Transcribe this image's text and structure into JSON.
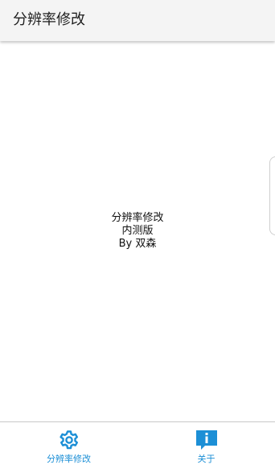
{
  "app_bar": {
    "title": "分辨率修改"
  },
  "main": {
    "line1": "分辨率修改",
    "line2": "内测版",
    "line3": "By 双森"
  },
  "bottom_nav": {
    "items": [
      {
        "label": "分辨率修改",
        "icon": "gear-icon"
      },
      {
        "label": "关于",
        "icon": "info-icon"
      }
    ]
  },
  "colors": {
    "accent": "#1c8fd6",
    "app_bar_bg": "#f4f4f4"
  }
}
